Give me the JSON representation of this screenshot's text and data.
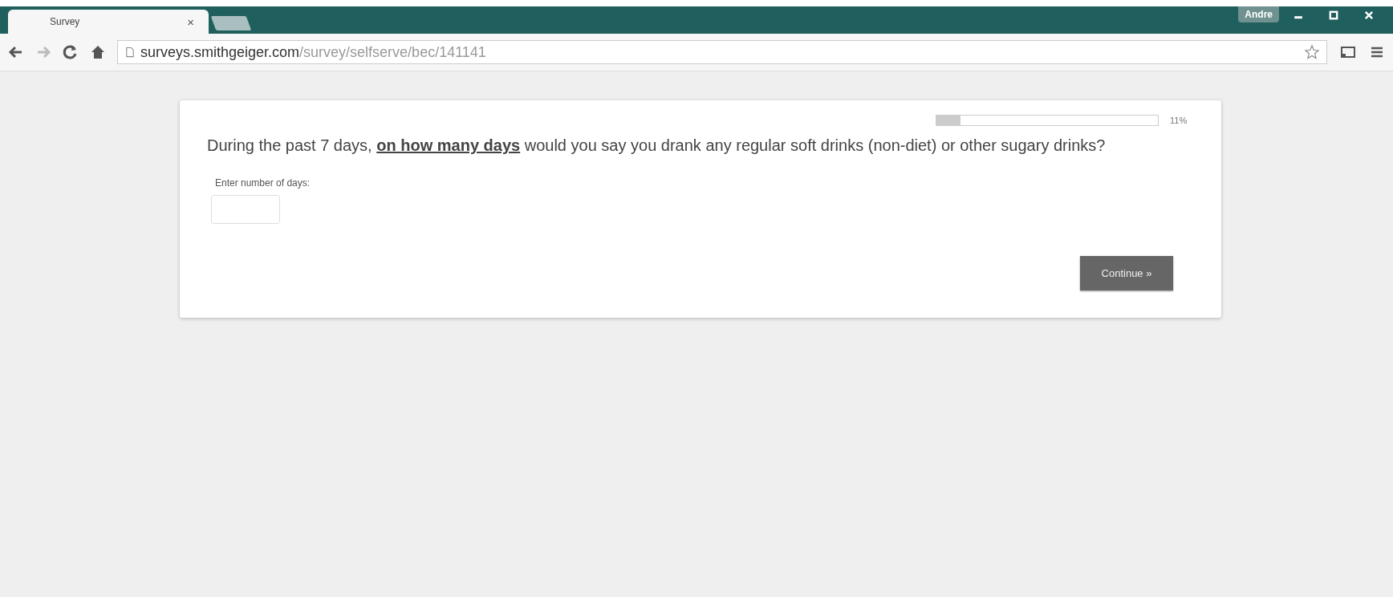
{
  "browser": {
    "tab": {
      "title": "Survey",
      "close": "×"
    },
    "profile": "Andre",
    "address": {
      "host": "surveys.smithgeiger.com",
      "path": "/survey/selfserve/bec/141141"
    }
  },
  "survey": {
    "progress": {
      "level": 0.11,
      "reading": "11%"
    },
    "question": "During the past 7 days, **on how many days** would you say you drank any regular soft drinks (non-diet) or other sugary drinks?",
    "field": {
      "label": "Enter number of days:"
    },
    "button": "Continue »"
  }
}
